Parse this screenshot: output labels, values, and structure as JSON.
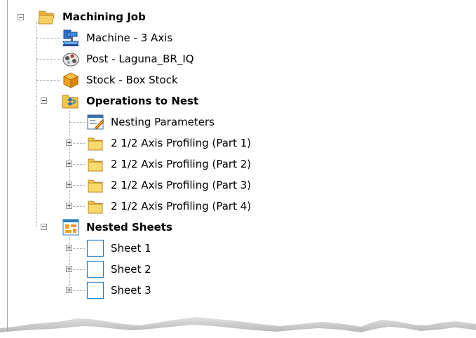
{
  "tree": {
    "root": {
      "label": "Machining Job",
      "expanded": true,
      "icon": "folder-open-icon"
    },
    "machine": {
      "label": "Machine - 3 Axis",
      "icon": "machine-icon"
    },
    "post": {
      "label": "Post - Laguna_BR_IQ",
      "icon": "post-processor-icon"
    },
    "stock": {
      "label": "Stock - Box Stock",
      "icon": "stock-box-icon"
    },
    "operations": {
      "label": "Operations to Nest",
      "expanded": true,
      "icon": "operations-nest-icon",
      "children": [
        {
          "label": "Nesting Parameters",
          "icon": "nesting-parameters-icon"
        },
        {
          "label": "2 1/2 Axis Profiling (Part 1)",
          "icon": "folder-icon",
          "expanded": false
        },
        {
          "label": "2 1/2 Axis Profiling (Part 2)",
          "icon": "folder-icon",
          "expanded": false
        },
        {
          "label": "2 1/2 Axis Profiling (Part 3)",
          "icon": "folder-icon",
          "expanded": false
        },
        {
          "label": "2 1/2 Axis Profiling (Part 4)",
          "icon": "folder-icon",
          "expanded": false
        }
      ]
    },
    "nested_sheets": {
      "label": "Nested Sheets",
      "expanded": true,
      "icon": "nested-sheets-icon",
      "children": [
        {
          "label": "Sheet 1",
          "icon": "sheet-icon",
          "expanded": false
        },
        {
          "label": "Sheet 2",
          "icon": "sheet-icon",
          "expanded": false
        },
        {
          "label": "Sheet 3",
          "icon": "sheet-icon",
          "expanded": false
        }
      ]
    }
  },
  "colors": {
    "folder_yellow": "#f5c542",
    "sheet_border": "#2a7fc0",
    "stock_orange": "#f0a020",
    "machine_blue": "#2060b0"
  }
}
